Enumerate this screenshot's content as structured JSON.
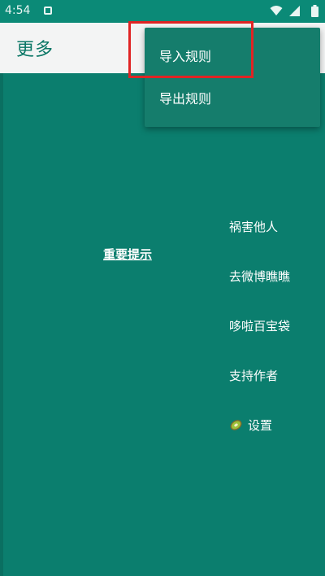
{
  "status_bar": {
    "time": "4:54",
    "icons": [
      "notification-icon",
      "wifi-icon",
      "signal-icon",
      "battery-icon"
    ]
  },
  "app_bar": {
    "title": "更多"
  },
  "popup_menu": {
    "items": [
      {
        "label": "导入规则",
        "highlighted": true
      },
      {
        "label": "导出规则"
      }
    ]
  },
  "main": {
    "notice_link": "重要提示",
    "menu": [
      {
        "label": "祸害他人"
      },
      {
        "label": "去微博瞧瞧"
      },
      {
        "label": "哆啦百宝袋"
      },
      {
        "label": "支持作者"
      },
      {
        "label": "设置",
        "icon": "kiwi-icon"
      }
    ]
  },
  "colors": {
    "primary": "#0b7e6e",
    "status_bar": "#0b8a77",
    "app_bar": "#f3f4f4",
    "title_text": "#0b7766",
    "popup_bg": "#157d6c",
    "highlight": "#e02424"
  }
}
